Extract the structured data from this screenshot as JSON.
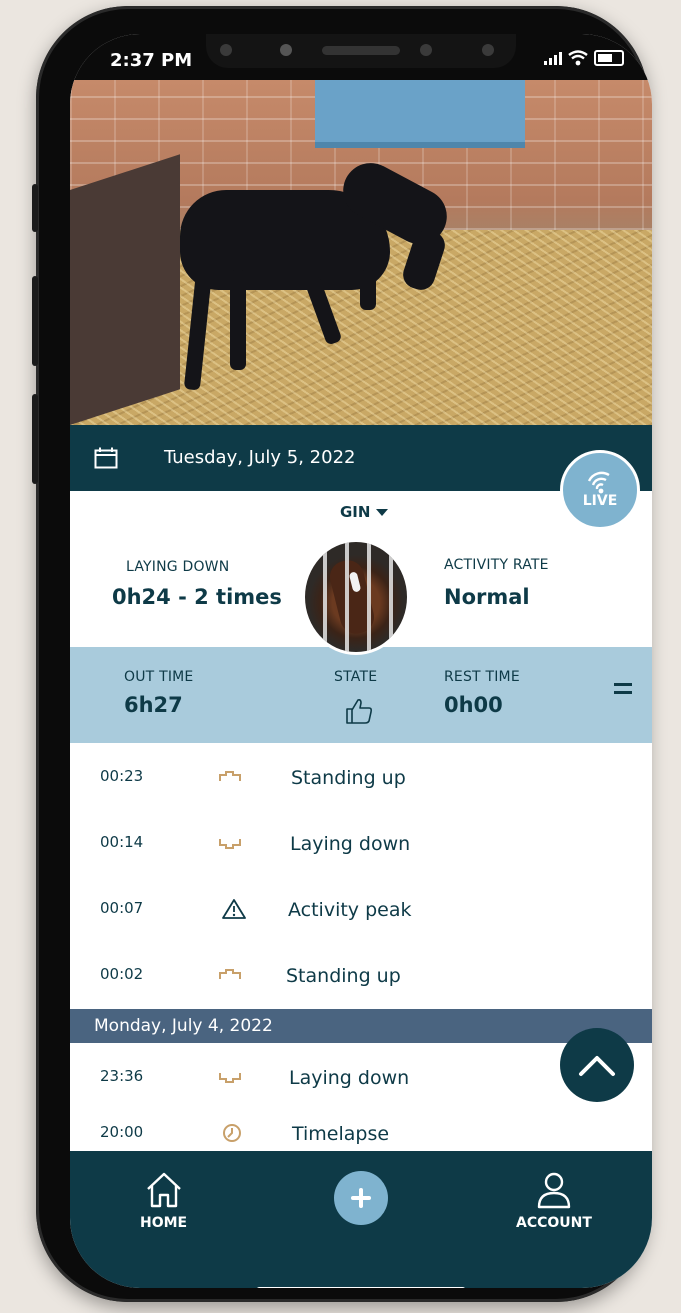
{
  "status_bar": {
    "time": "2:37 PM"
  },
  "date_bar": {
    "date": "Tuesday, July 5, 2022"
  },
  "live_badge": {
    "label": "LIVE"
  },
  "horse": {
    "name": "GIN"
  },
  "summary": {
    "laying_down_label": "LAYING DOWN",
    "laying_down_value": "0h24 - 2 times",
    "activity_rate_label": "ACTIVITY RATE",
    "activity_rate_value": "Normal"
  },
  "stats_band": {
    "out_time_label": "OUT TIME",
    "out_time_value": "6h27",
    "state_label": "STATE",
    "rest_time_label": "REST TIME",
    "rest_time_value": "0h00"
  },
  "events_today": [
    {
      "time": "00:23",
      "icon": "standing-up-icon",
      "label": "Standing up"
    },
    {
      "time": "00:14",
      "icon": "laying-down-icon",
      "label": "Laying down"
    },
    {
      "time": "00:07",
      "icon": "warning-icon",
      "label": "Activity peak"
    },
    {
      "time": "00:02",
      "icon": "standing-up-icon",
      "label": "Standing up"
    }
  ],
  "previous_day": {
    "header": "Monday, July 4, 2022",
    "events": [
      {
        "time": "23:36",
        "icon": "laying-down-icon",
        "label": "Laying down"
      },
      {
        "time": "20:00",
        "icon": "clock-icon",
        "label": "Timelapse"
      }
    ]
  },
  "nav": {
    "home_label": "HOME",
    "account_label": "ACCOUNT"
  },
  "colors": {
    "primary": "#0e3a47",
    "band": "#a9cbdc",
    "accent": "#7fb3cf",
    "day_header": "#4a6480",
    "event_icon": "#c8a06a"
  }
}
